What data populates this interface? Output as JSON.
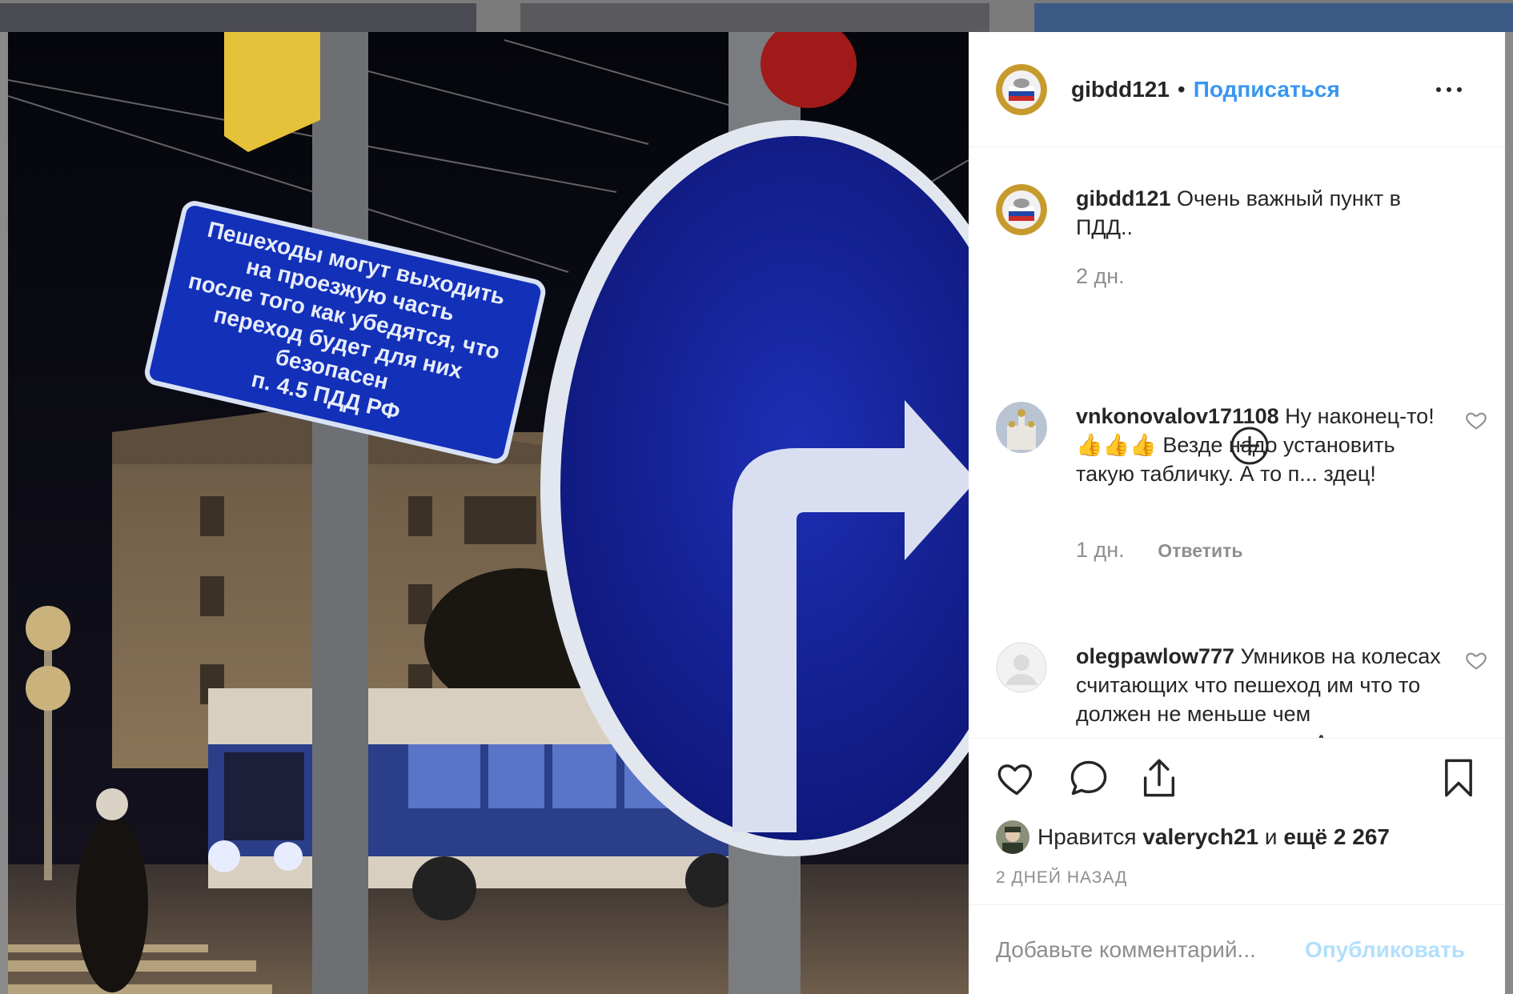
{
  "header": {
    "username": "gibdd121",
    "separator": "•",
    "follow_label": "Подписаться",
    "more_icon": "more-horizontal-icon"
  },
  "caption": {
    "username": "gibdd121",
    "text": "Очень важный пункт в ПДД..",
    "time": "2 дн."
  },
  "photo_sign": {
    "lines": [
      "Пешеходы могут выходить",
      "на проезжую часть",
      "после того как убедятся, что",
      "переход будет для них безопасен",
      "п. 4.5 ПДД РФ"
    ]
  },
  "comments": [
    {
      "username": "vnkonovalov171108",
      "text": "Ну наконец-то! 👍👍👍 Везде надо установить такую табличку. А то п... здец!",
      "time": "1 дн.",
      "reply_label": "Ответить"
    },
    {
      "username": "olegpawlow777",
      "text": "Умников на колесах считающих что пешеход им что то должен не меньше чем прямоходящих умнико. А по"
    }
  ],
  "likes": {
    "prefix": "Нравится",
    "user": "valerych21",
    "conj": "и",
    "more": "ещё 2 267"
  },
  "post_date": "2 ДНЕЙ НАЗАД",
  "add_comment": {
    "placeholder": "Добавьте комментарий...",
    "publish_label": "Опубликовать"
  },
  "colors": {
    "link": "#3897f0",
    "muted": "#8e8e8e",
    "publish_disabled": "#b2dffc",
    "text": "#262626"
  }
}
